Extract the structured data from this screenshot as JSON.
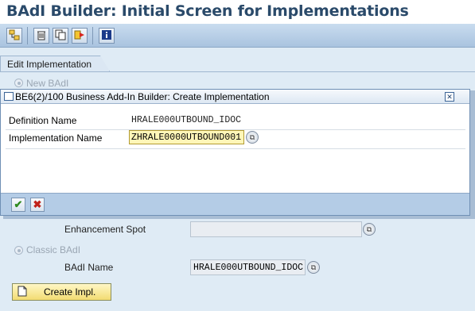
{
  "window": {
    "title": "BAdI Builder: Initial Screen for Implementations"
  },
  "toolbar": {
    "buttons": [
      {
        "icon": "hierarchy-icon"
      },
      {
        "icon": "delete-icon"
      },
      {
        "icon": "copy-icon"
      },
      {
        "icon": "transport-icon"
      },
      {
        "icon": "info-icon",
        "color": "#1b3a8a"
      }
    ]
  },
  "tab": {
    "label": "Edit Implementation"
  },
  "radio_new": {
    "label": "New BAdI"
  },
  "enhancement_spot": {
    "label": "Enhancement Spot",
    "value": ""
  },
  "radio_classic": {
    "label": "Classic BAdI"
  },
  "badi_name": {
    "label": "BAdI Name",
    "value": "HRALE000UTBOUND_IDOC"
  },
  "create_button": {
    "label": "Create Impl."
  },
  "dialog": {
    "title": "BE6(2)/100 Business Add-In Builder: Create Implementation",
    "definition_name_label": "Definition Name",
    "definition_name_value": "HRALE000UTBOUND_IDOC",
    "impl_name_label": "Implementation Name",
    "impl_name_value": "ZHRALE0000UTBOUND001"
  },
  "colors": {
    "title_text": "#2a4a6a",
    "background": "#dfebf5",
    "input_highlight": "#fff6b8",
    "confirm_green": "#2f8a1f",
    "cancel_red": "#c0211a"
  }
}
